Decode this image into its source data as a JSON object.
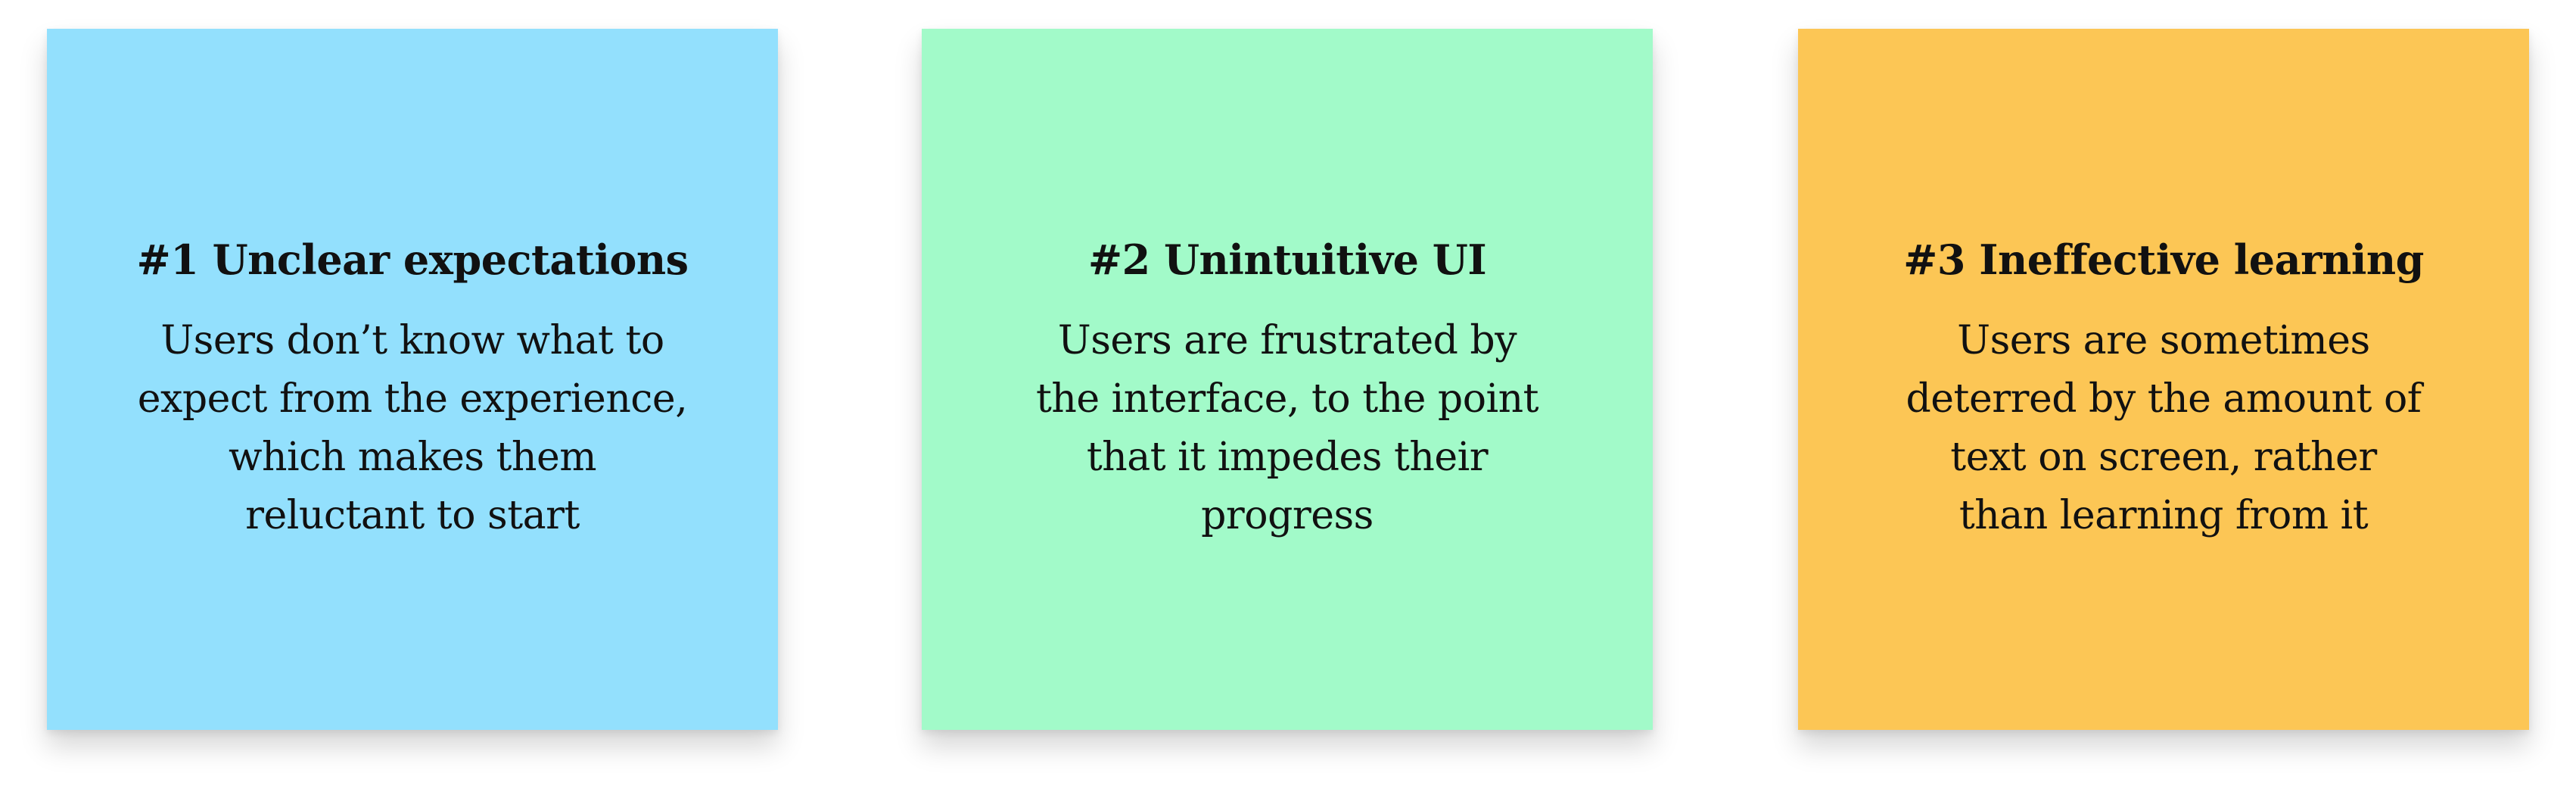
{
  "notes": [
    {
      "title": "#1 Unclear expectations",
      "body_lines": [
        "Users don’t know what to",
        "expect from the experience,",
        "which makes them",
        "reluctant to start"
      ],
      "color": "#93E0FD"
    },
    {
      "title": "#2 Unintuitive UI",
      "body_lines": [
        "Users are frustrated by",
        "the interface, to the point",
        "that it impedes their",
        "progress"
      ],
      "color": "#A2FAC9"
    },
    {
      "title": "#3 Ineffective learning",
      "body_lines": [
        "Users are sometimes",
        "deterred by the amount of",
        "text on screen, rather",
        "than learning from it"
      ],
      "color": "#FCC655"
    }
  ]
}
